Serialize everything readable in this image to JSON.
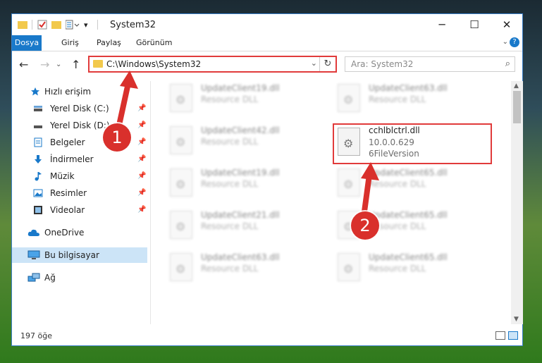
{
  "window": {
    "title": "System32"
  },
  "ribbon": {
    "tabs": [
      "Dosya",
      "Giriş",
      "Paylaş",
      "Görünüm"
    ]
  },
  "address": {
    "path": "C:\\Windows\\System32"
  },
  "search": {
    "placeholder": "Ara: System32"
  },
  "sidebar": {
    "items": [
      {
        "label": "Hızlı erişim",
        "icon": "star-icon"
      },
      {
        "label": "Yerel Disk (C:)",
        "icon": "drive-icon",
        "pinned": true
      },
      {
        "label": "Yerel Disk (D:)",
        "icon": "drive-icon",
        "pinned": true
      },
      {
        "label": "Belgeler",
        "icon": "documents-icon",
        "pinned": true
      },
      {
        "label": "İndirmeler",
        "icon": "download-icon",
        "pinned": true
      },
      {
        "label": "Müzik",
        "icon": "music-icon",
        "pinned": true
      },
      {
        "label": "Resimler",
        "icon": "pictures-icon",
        "pinned": true
      },
      {
        "label": "Videolar",
        "icon": "videos-icon",
        "pinned": true
      },
      {
        "label": "OneDrive",
        "icon": "cloud-icon"
      },
      {
        "label": "Bu bilgisayar",
        "icon": "computer-icon",
        "selected": true
      },
      {
        "label": "Ağ",
        "icon": "network-icon"
      }
    ]
  },
  "files": {
    "left": [
      {
        "name": "UpdateClient19.dll",
        "type": "Resource DLL"
      },
      {
        "name": "UpdateClient42.dll",
        "type": "Resource DLL"
      },
      {
        "name": "UpdateClient19.dll",
        "type": "Resource DLL"
      },
      {
        "name": "UpdateClient21.dll",
        "type": "Resource DLL"
      },
      {
        "name": "UpdateClient63.dll",
        "type": "Resource DLL"
      }
    ],
    "right": [
      {
        "name": "UpdateClient63.dll",
        "type": "Resource DLL"
      },
      {
        "name": "cchlblctrl.dll",
        "version": "10.0.0.629",
        "type": "6FileVersion",
        "highlighted": true
      },
      {
        "name": "UpdateClient65.dll",
        "type": "Resource DLL"
      },
      {
        "name": "UpdateClient65.dll",
        "type": "Resource DLL"
      },
      {
        "name": "UpdateClient65.dll",
        "type": "Resource DLL"
      }
    ]
  },
  "status": {
    "item_count": "197 öğe"
  },
  "annotations": {
    "step1": "1",
    "step2": "2"
  },
  "colors": {
    "accent": "#1979ca",
    "highlight": "#e13b3b"
  }
}
